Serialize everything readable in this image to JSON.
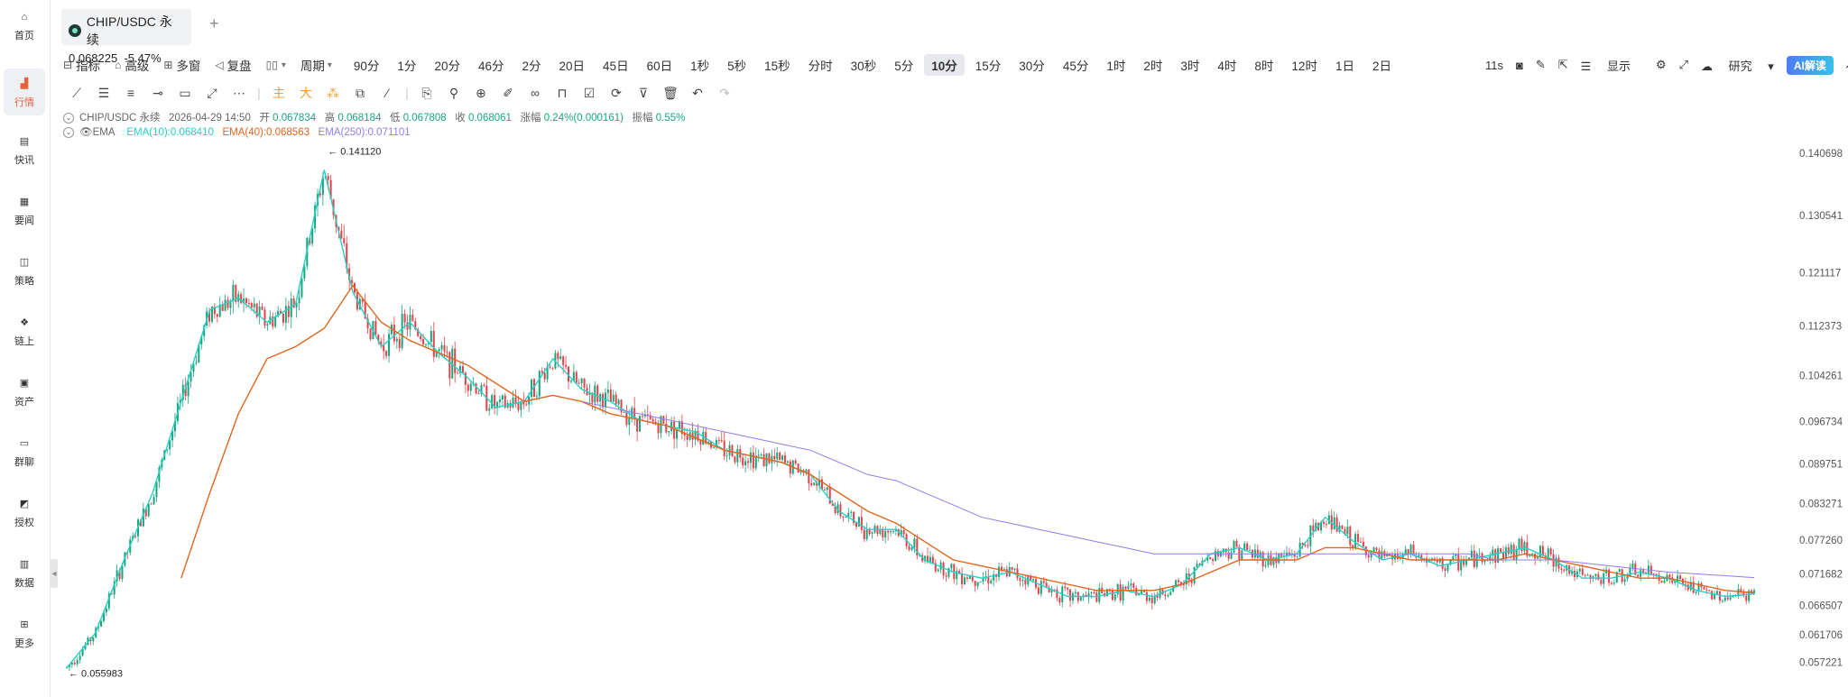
{
  "sidebar": {
    "items": [
      {
        "label": "首页",
        "icon": "home-icon"
      },
      {
        "label": "行情",
        "icon": "market-chart-icon",
        "active": true
      },
      {
        "label": "快讯",
        "icon": "flash-news-icon"
      },
      {
        "label": "要闻",
        "icon": "news-icon"
      },
      {
        "label": "策略",
        "icon": "strategy-robot-icon"
      },
      {
        "label": "链上",
        "icon": "onchain-icon"
      },
      {
        "label": "资产",
        "icon": "wallet-icon"
      },
      {
        "label": "群聊",
        "icon": "chat-icon"
      },
      {
        "label": "授权",
        "icon": "authorize-icon"
      },
      {
        "label": "数据",
        "icon": "data-icon"
      },
      {
        "label": "更多",
        "icon": "more-grid-icon"
      }
    ]
  },
  "tab": {
    "pair": "CHIP/USDC 永续",
    "price": "0.068225",
    "change": "-5.47%"
  },
  "toolbar": {
    "indicator": "指标",
    "advanced": "高级",
    "multi": "多窗",
    "replay": "复盘",
    "period": "周期",
    "periods": [
      "90分",
      "1分",
      "20分",
      "46分",
      "2分",
      "20日",
      "45日",
      "60日",
      "1秒",
      "5秒",
      "15秒",
      "分时",
      "30秒",
      "5分",
      "10分",
      "15分",
      "30分",
      "45分",
      "1时",
      "2时",
      "3时",
      "4时",
      "8时",
      "12时",
      "1日",
      "2日"
    ],
    "active_period": "10分",
    "refresh": "11s",
    "display": "显示",
    "research": "研究",
    "ai": "AI解读"
  },
  "ohlc": {
    "symbol": "CHIP/USDC 永续",
    "datetime": "2026-04-29 14:50",
    "open_label": "开",
    "open": "0.067834",
    "high_label": "高",
    "high": "0.068184",
    "low_label": "低",
    "low": "0.067808",
    "close_label": "收",
    "close": "0.068061",
    "change_label": "涨幅",
    "change": "0.24%(0.000161)",
    "amp_label": "振幅",
    "amp": "0.55%"
  },
  "ema": {
    "name": "EMA",
    "ema10": "EMA(10):0.068410",
    "ema40": "EMA(40):0.068563",
    "ema250": "EMA(250):0.071101"
  },
  "colors": {
    "up": "#17a77f",
    "down": "#e8404a",
    "ema10": "#25d0c8",
    "ema40": "#e0661e",
    "ema250": "#8f7ee8",
    "accent": "#e8613c"
  },
  "chart_data": {
    "type": "line",
    "title": "",
    "xlabel": "",
    "ylabel": "",
    "ylim": [
      0.0555,
      0.1425
    ],
    "y_ticks": [
      "0.140698",
      "0.130541",
      "0.121117",
      "0.112373",
      "0.104261",
      "0.096734",
      "0.089751",
      "0.083271",
      "0.077260",
      "0.071682",
      "0.066507",
      "0.061706",
      "0.057221"
    ],
    "high_marker": "0.141120",
    "low_marker": "0.055983",
    "series": [
      {
        "name": "EMA(10)",
        "values": [
          0.0563,
          0.062,
          0.074,
          0.085,
          0.1,
          0.115,
          0.117,
          0.113,
          0.116,
          0.138,
          0.118,
          0.109,
          0.113,
          0.108,
          0.104,
          0.099,
          0.1,
          0.107,
          0.102,
          0.1,
          0.097,
          0.096,
          0.095,
          0.092,
          0.091,
          0.09,
          0.088,
          0.082,
          0.079,
          0.079,
          0.074,
          0.072,
          0.071,
          0.072,
          0.07,
          0.068,
          0.068,
          0.069,
          0.068,
          0.07,
          0.075,
          0.076,
          0.074,
          0.075,
          0.081,
          0.077,
          0.074,
          0.075,
          0.073,
          0.074,
          0.075,
          0.076,
          0.074,
          0.071,
          0.071,
          0.072,
          0.071,
          0.069,
          0.068,
          0.0684
        ]
      },
      {
        "name": "EMA(40)",
        "values": [
          null,
          null,
          null,
          null,
          0.071,
          0.085,
          0.098,
          0.107,
          0.109,
          0.112,
          0.119,
          0.113,
          0.11,
          0.108,
          0.106,
          0.103,
          0.1,
          0.101,
          0.1,
          0.098,
          0.097,
          0.096,
          0.094,
          0.092,
          0.091,
          0.09,
          0.088,
          0.085,
          0.082,
          0.08,
          0.077,
          0.074,
          0.073,
          0.072,
          0.071,
          0.07,
          0.069,
          0.069,
          0.069,
          0.07,
          0.072,
          0.074,
          0.074,
          0.074,
          0.076,
          0.076,
          0.075,
          0.074,
          0.074,
          0.074,
          0.074,
          0.075,
          0.074,
          0.073,
          0.072,
          0.071,
          0.071,
          0.07,
          0.069,
          0.0686
        ]
      },
      {
        "name": "EMA(250)",
        "values": [
          null,
          null,
          null,
          null,
          null,
          null,
          null,
          null,
          null,
          null,
          null,
          null,
          null,
          null,
          null,
          null,
          null,
          null,
          0.1,
          0.099,
          0.098,
          0.097,
          0.096,
          0.095,
          0.094,
          0.093,
          0.092,
          0.09,
          0.088,
          0.087,
          0.085,
          0.083,
          0.081,
          0.08,
          0.079,
          0.078,
          0.077,
          0.076,
          0.075,
          0.075,
          0.075,
          0.075,
          0.075,
          0.075,
          0.075,
          0.075,
          0.075,
          0.075,
          0.075,
          0.075,
          0.074,
          0.074,
          0.074,
          0.0735,
          0.073,
          0.0725,
          0.072,
          0.0717,
          0.0714,
          0.0711
        ]
      }
    ]
  }
}
